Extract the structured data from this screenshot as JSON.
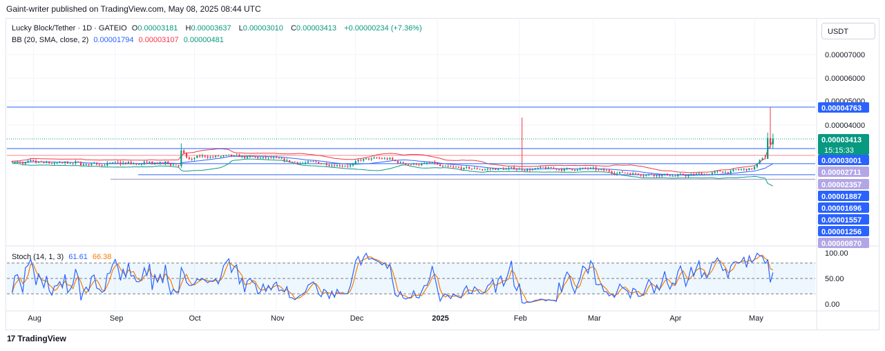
{
  "header": {
    "published_text": "Gaint-writer published on TradingView.com, May 08, 2025 08:44 UTC"
  },
  "legend": {
    "symbol": "Lucky Block/Tether · 1D · GATEIO",
    "o_key": "O",
    "o_val": "0.00003181",
    "h_key": "H",
    "h_val": "0.00003637",
    "l_key": "L",
    "l_val": "0.00003010",
    "c_key": "C",
    "c_val": "0.00003413",
    "change": "+0.00000234 (+7.36%)",
    "bb_label": "BB (20, SMA, close, 2)",
    "bb_basis": "0.00001794",
    "bb_upper": "0.00003107",
    "bb_lower": "0.00000481",
    "stoch_label": "Stoch (14, 1, 3)",
    "stoch_k": "61.61",
    "stoch_d": "66.38"
  },
  "currency_button": "USDT",
  "footer": {
    "brand": "TradingView",
    "logo_glyph": "17"
  },
  "colors": {
    "up": "#089981",
    "down": "#f23645",
    "bb_upper": "#f23645",
    "bb_basis": "#2962ff",
    "bb_lower": "#089981",
    "stoch_k": "#2962ff",
    "stoch_d": "#f57c00",
    "hline_blue": "#2962ff",
    "hline_purple": "#9c8fd0",
    "label_purple": "#b2a6e6"
  },
  "chart_data": [
    {
      "type": "candlestick",
      "title": "Lucky Block/Tether · 1D · GATEIO",
      "x_tick_labels": [
        "Aug",
        "Sep",
        "Oct",
        "Nov",
        "Dec",
        "2025",
        "Feb",
        "Mar",
        "Apr",
        "May"
      ],
      "x_range": [
        "2024-07-22",
        "2025-05-24"
      ],
      "y_range": [
        8.7e-06,
        7.7e-06
      ],
      "y_tick_labels": [
        "0.00007000",
        "0.00006000",
        "0.00005000",
        "0.00004000"
      ],
      "y_tick_values": [
        7e-05,
        6e-05,
        5e-05,
        4e-05
      ],
      "y_ticks_note": "price axis is non-linear between labelled levels; tick values are read from the axis labels",
      "price_levels": [
        {
          "label": "0.00004763",
          "value": 4.763e-05,
          "style": "blue-solid"
        },
        {
          "label": "0.00003413",
          "value": 3.413e-05,
          "style": "last-price",
          "countdown": "15:15:33"
        },
        {
          "label": "0.00003001",
          "value": 3.001e-05,
          "style": "blue-solid"
        },
        {
          "label": "0.00002711",
          "value": 2.711e-05,
          "style": "purple"
        },
        {
          "label": "0.00002357",
          "value": 2.357e-05,
          "style": "purple"
        },
        {
          "label": "0.00001887",
          "value": 1.887e-05,
          "style": "blue-solid"
        },
        {
          "label": "0.00001696",
          "value": 1.696e-05,
          "style": "blue-solid"
        },
        {
          "label": "0.00001557",
          "value": 1.557e-05,
          "style": "blue-solid"
        },
        {
          "label": "0.00001256",
          "value": 1.256e-05,
          "style": "blue-solid"
        },
        {
          "label": "0.00000870",
          "value": 8.7e-06,
          "style": "purple"
        }
      ],
      "last_ohlc": {
        "open": 3.181e-05,
        "high": 3.637e-05,
        "low": 3.01e-05,
        "close": 3.413e-05
      },
      "bollinger": {
        "basis": 1.794e-05,
        "upper": 3.107e-05,
        "lower": 4.81e-06
      },
      "notes": "Daily candles Jul 2024 – May 2025; long consolidation around 0.000016–0.000026 with spikes in late Sep and early Feb (wick to ~0.000043); breakout in early May 2025 with wick to ~0.0000476."
    },
    {
      "type": "line",
      "title": "Stoch (14, 1, 3)",
      "y_tick_labels": [
        "100.00",
        "50.00",
        "0.00"
      ],
      "y_tick_values": [
        100,
        50,
        0
      ],
      "bands": [
        80,
        20
      ],
      "series": [
        {
          "name": "%K",
          "last": 61.61
        },
        {
          "name": "%D",
          "last": 66.38
        }
      ]
    }
  ]
}
